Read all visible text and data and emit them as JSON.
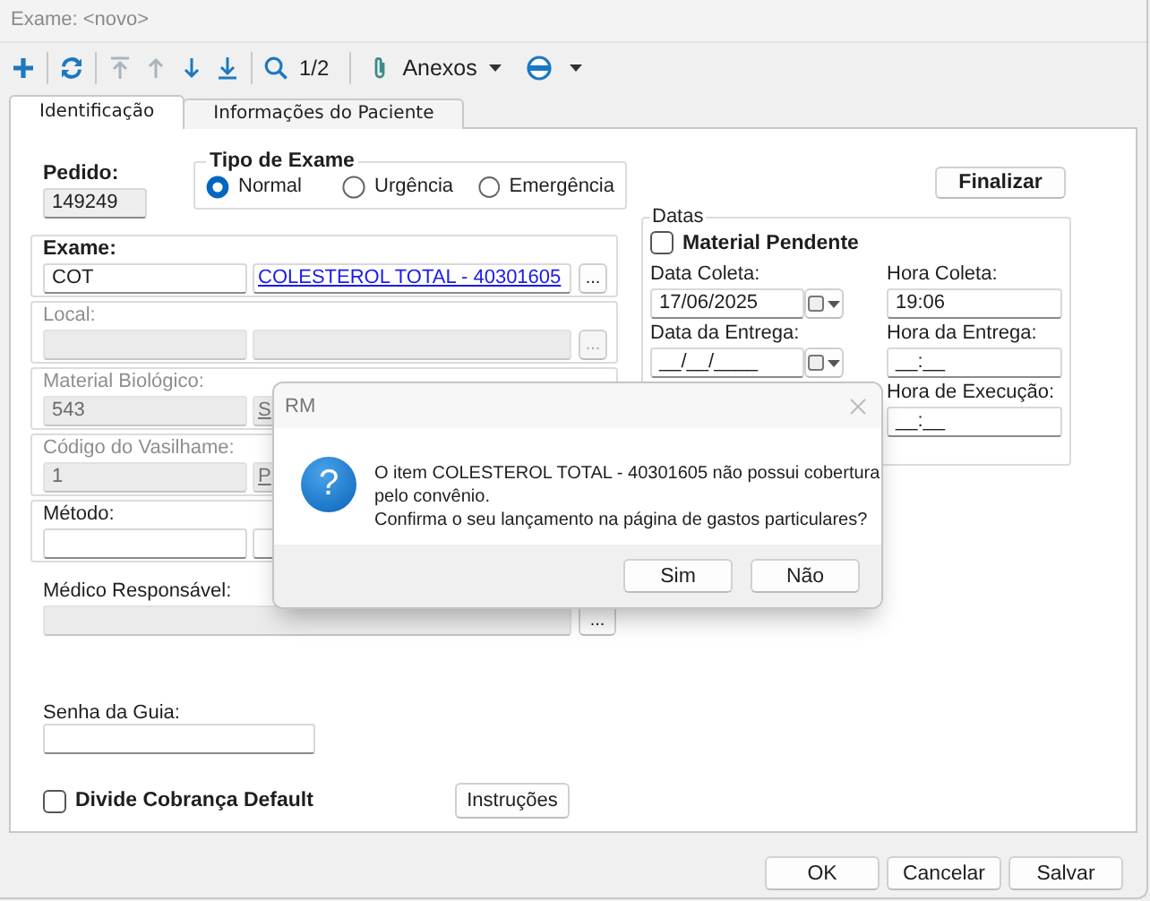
{
  "window": {
    "title": "Exame: <novo>"
  },
  "toolbar": {
    "items": [
      {
        "kind": "add",
        "disabled": false
      },
      {
        "kind": "refresh",
        "disabled": false
      },
      {
        "kind": "first",
        "disabled": true
      },
      {
        "kind": "up",
        "disabled": true
      },
      {
        "kind": "down",
        "disabled": false
      },
      {
        "kind": "last",
        "disabled": false
      },
      {
        "kind": "search",
        "disabled": false
      },
      {
        "kind": "page",
        "text": "1/2"
      },
      {
        "kind": "attachments",
        "text": "Anexos"
      },
      {
        "kind": "media",
        "disabled": false
      }
    ]
  },
  "tabs": [
    {
      "label": "Identificação",
      "selected": true
    },
    {
      "label": "Informações do Paciente",
      "selected": false
    }
  ],
  "pedido": {
    "label": "Pedido:",
    "value": "149249"
  },
  "tipo_exame": {
    "title": "Tipo de Exame",
    "options": [
      {
        "label": "Normal",
        "selected": true
      },
      {
        "label": "Urgência",
        "selected": false
      },
      {
        "label": "Emergência",
        "selected": false
      }
    ]
  },
  "field_groups": [
    {
      "label": "Exame:",
      "required": true,
      "disabled": false,
      "fields": [
        {
          "kind": "text",
          "value": "COT"
        },
        {
          "kind": "link",
          "value": "COLESTEROL TOTAL - 40301605"
        }
      ],
      "browse": "..."
    },
    {
      "label": "Local:",
      "required": false,
      "disabled": true,
      "fields": [
        {
          "kind": "text"
        },
        {
          "kind": "text"
        }
      ],
      "browse": "..."
    },
    {
      "label": "Material Biológico:",
      "required": false,
      "disabled": true,
      "fields": [
        {
          "kind": "text",
          "value": "543"
        },
        {
          "kind": "link",
          "value": "S"
        }
      ]
    },
    {
      "label": "Código do Vasilhame:",
      "required": false,
      "disabled": true,
      "fields": [
        {
          "kind": "text",
          "value": "1"
        },
        {
          "kind": "link",
          "value": "P"
        }
      ]
    },
    {
      "label": "Método:",
      "required": false,
      "disabled": false,
      "fields": [
        {
          "kind": "text"
        },
        {
          "kind": "text"
        }
      ]
    }
  ],
  "medico": {
    "label": "Médico Responsável:",
    "disabled": true,
    "browse": "..."
  },
  "senha": {
    "label": "Senha da Guia:"
  },
  "divide": {
    "label": "Divide Cobrança Default",
    "checked": false
  },
  "instructions_button": "Instruções",
  "finalize_button": "Finalizar",
  "datas": {
    "title": "Datas",
    "pending": {
      "label": "Material Pendente",
      "checked": false
    },
    "fields": [
      {
        "kind": "date",
        "label": "Data Coleta:",
        "value": "17/06/2025"
      },
      {
        "kind": "time",
        "label": "Hora Coleta:",
        "value": "19:06"
      },
      {
        "kind": "date",
        "label": "Data da Entrega:",
        "value": "__/__/____"
      },
      {
        "kind": "time",
        "label": "Hora da Entrega:",
        "value": "__:__"
      },
      {
        "kind": "time",
        "label": "Hora de Execução:",
        "value": "__:__"
      }
    ]
  },
  "dialog": {
    "title": "RM",
    "icon": "?",
    "message": "O item COLESTEROL TOTAL - 40301605 não possui cobertura\npelo convênio.\nConfirma o seu lançamento na página de gastos particulares?",
    "buttons": [
      "Sim",
      "Não"
    ]
  },
  "footer_buttons": [
    "OK",
    "Cancelar",
    "Salvar"
  ]
}
